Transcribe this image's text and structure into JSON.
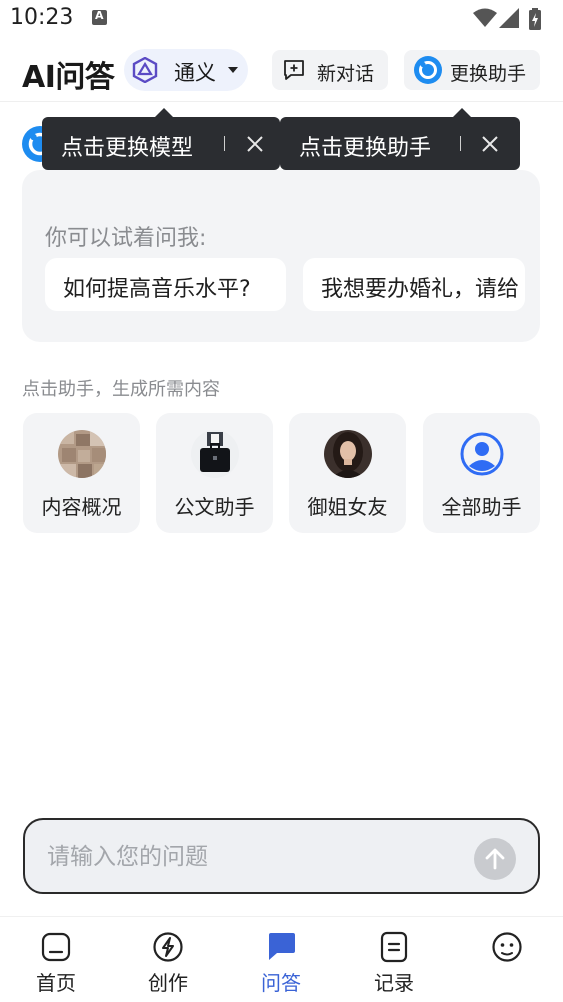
{
  "status_bar": {
    "time": "10:23"
  },
  "header": {
    "title": "AI问答",
    "model_label": "通义",
    "new_chat_label": "新对话",
    "swap_assistant_label": "更换助手"
  },
  "tooltips": {
    "model": "点击更换模型",
    "assistant": "点击更换助手",
    "separator": "I"
  },
  "suggestions": {
    "prompt": "你可以试着问我:",
    "chips": [
      "如何提高音乐水平?",
      "我想要办婚礼，请给"
    ]
  },
  "assistants": {
    "section_label": "点击助手，生成所需内容",
    "items": [
      {
        "label": "内容概况",
        "icon": "wood-texture-avatar"
      },
      {
        "label": "公文助手",
        "icon": "briefcase-avatar"
      },
      {
        "label": "御姐女友",
        "icon": "portrait-avatar"
      },
      {
        "label": "全部助手",
        "icon": "user-circle-icon"
      }
    ]
  },
  "input": {
    "placeholder": "请输入您的问题"
  },
  "bottom_nav": {
    "active": "问答",
    "items": [
      {
        "label": "首页",
        "icon": "home-icon"
      },
      {
        "label": "创作",
        "icon": "lightning-icon"
      },
      {
        "label": "问答",
        "icon": "chat-bubble-icon"
      },
      {
        "label": "记录",
        "icon": "list-icon"
      },
      {
        "label": "",
        "icon": "smiley-icon"
      }
    ]
  },
  "colors": {
    "accent": "#3a63d6",
    "tooltip_bg": "#2b2d31",
    "card_bg": "#f3f4f6",
    "model_pill_bg": "#eef2fc"
  }
}
